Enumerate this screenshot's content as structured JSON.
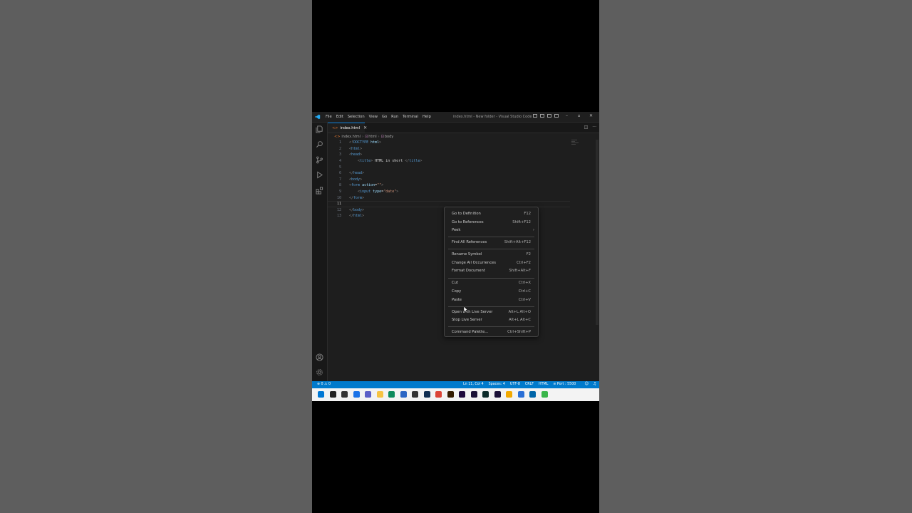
{
  "window": {
    "menu": [
      "File",
      "Edit",
      "Selection",
      "View",
      "Go",
      "Run",
      "Terminal",
      "Help"
    ],
    "title": "index.html - New folder - Visual Studio Code",
    "controls": [
      "–",
      "▫",
      "✕"
    ]
  },
  "tab": {
    "label": "index.html",
    "close": "✕",
    "icon": "html-file-icon"
  },
  "breadcrumb": [
    "index.html",
    "html",
    "body"
  ],
  "editor": {
    "current_line": 11,
    "lines": [
      {
        "n": "1",
        "parts": [
          [
            "br",
            "<!"
          ],
          [
            "tag",
            "DOCTYPE"
          ],
          [
            "txt",
            " "
          ],
          [
            "attr",
            "html"
          ],
          [
            "br",
            ">"
          ]
        ]
      },
      {
        "n": "2",
        "parts": [
          [
            "br",
            "<"
          ],
          [
            "tag",
            "html"
          ],
          [
            "br",
            ">"
          ]
        ]
      },
      {
        "n": "3",
        "parts": [
          [
            "br",
            "<"
          ],
          [
            "tag",
            "head"
          ],
          [
            "br",
            ">"
          ]
        ]
      },
      {
        "n": "4",
        "parts": [
          [
            "txt",
            "    "
          ],
          [
            "br",
            "<"
          ],
          [
            "tag",
            "title"
          ],
          [
            "br",
            ">"
          ],
          [
            "txt",
            " HTML in short "
          ],
          [
            "br",
            "</"
          ],
          [
            "tag",
            "title"
          ],
          [
            "br",
            ">"
          ]
        ]
      },
      {
        "n": "5",
        "parts": []
      },
      {
        "n": "6",
        "parts": [
          [
            "br",
            "</"
          ],
          [
            "tag",
            "head"
          ],
          [
            "br",
            ">"
          ]
        ]
      },
      {
        "n": "7",
        "parts": [
          [
            "br",
            "<"
          ],
          [
            "tag",
            "body"
          ],
          [
            "br",
            ">"
          ]
        ]
      },
      {
        "n": "8",
        "parts": [
          [
            "br",
            "<"
          ],
          [
            "tag",
            "form"
          ],
          [
            "txt",
            " "
          ],
          [
            "attr",
            "action"
          ],
          [
            "txt",
            "="
          ],
          [
            "str",
            "\"\""
          ],
          [
            "br",
            ">"
          ]
        ]
      },
      {
        "n": "9",
        "parts": [
          [
            "txt",
            "    "
          ],
          [
            "br",
            "<"
          ],
          [
            "tag",
            "input"
          ],
          [
            "txt",
            " "
          ],
          [
            "attr",
            "type"
          ],
          [
            "txt",
            "="
          ],
          [
            "str",
            "\"date\""
          ],
          [
            "br",
            ">"
          ]
        ]
      },
      {
        "n": "10",
        "parts": [
          [
            "br",
            "</"
          ],
          [
            "tag",
            "form"
          ],
          [
            "br",
            ">"
          ]
        ]
      },
      {
        "n": "11",
        "parts": []
      },
      {
        "n": "12",
        "parts": [
          [
            "br",
            "</"
          ],
          [
            "tag",
            "body"
          ],
          [
            "br",
            ">"
          ]
        ]
      },
      {
        "n": "13",
        "parts": [
          [
            "br",
            "</"
          ],
          [
            "tag",
            "html"
          ],
          [
            "br",
            ">"
          ]
        ]
      }
    ]
  },
  "context_menu": {
    "groups": [
      [
        {
          "label": "Go to Definition",
          "key": "F12"
        },
        {
          "label": "Go to References",
          "key": "Shift+F12"
        },
        {
          "label": "Peek",
          "key": "",
          "submenu": "›"
        }
      ],
      [
        {
          "label": "Find All References",
          "key": "Shift+Alt+F12"
        }
      ],
      [
        {
          "label": "Rename Symbol",
          "key": "F2"
        },
        {
          "label": "Change All Occurrences",
          "key": "Ctrl+F2"
        },
        {
          "label": "Format Document",
          "key": "Shift+Alt+F"
        }
      ],
      [
        {
          "label": "Cut",
          "key": "Ctrl+X"
        },
        {
          "label": "Copy",
          "key": "Ctrl+C"
        },
        {
          "label": "Paste",
          "key": "Ctrl+V"
        }
      ],
      [
        {
          "label": "Open with Live Server",
          "key": "Alt+L Alt+O"
        },
        {
          "label": "Stop Live Server",
          "key": "Alt+L Alt+C"
        }
      ],
      [
        {
          "label": "Command Palette...",
          "key": "Ctrl+Shift+P"
        }
      ]
    ]
  },
  "statusbar": {
    "problems": "⊗ 0 ⚠ 0",
    "position": "Ln 11, Col 4",
    "spaces": "Spaces: 4",
    "encoding": "UTF-8",
    "eol": "CRLF",
    "language": "HTML",
    "port": "⊘ Port : 5500"
  },
  "colors": {
    "editor_bg": "#1e1e1e",
    "statusbar": "#007acc",
    "tag": "#569cd6",
    "attr": "#9cdcfe",
    "string": "#ce9178"
  },
  "taskbar_icons": [
    {
      "name": "start-icon",
      "color": "#0078d4"
    },
    {
      "name": "search-icon",
      "color": "#222222"
    },
    {
      "name": "task-view-icon",
      "color": "#333333"
    },
    {
      "name": "widgets-icon",
      "color": "#1a73e8"
    },
    {
      "name": "chat-icon",
      "color": "#5b5fc7"
    },
    {
      "name": "file-explorer-icon",
      "color": "#f6c342"
    },
    {
      "name": "edge-icon",
      "color": "#0c8a5c"
    },
    {
      "name": "store-icon",
      "color": "#2b66c4"
    },
    {
      "name": "obs-icon",
      "color": "#333333"
    },
    {
      "name": "photoshop-icon",
      "color": "#0f2d50"
    },
    {
      "name": "chrome-icon",
      "color": "#db4437"
    },
    {
      "name": "illustrator-icon",
      "color": "#331c00"
    },
    {
      "name": "after-effects-icon",
      "color": "#1f0a3d"
    },
    {
      "name": "premiere-icon",
      "color": "#1b1137"
    },
    {
      "name": "audition-icon",
      "color": "#0b2a29"
    },
    {
      "name": "media-encoder-icon",
      "color": "#1b1137"
    },
    {
      "name": "chrome-canary-icon",
      "color": "#f2a900"
    },
    {
      "name": "notepad-icon",
      "color": "#2a6fd6"
    },
    {
      "name": "vscode-icon",
      "color": "#0065a9"
    },
    {
      "name": "browser-icon",
      "color": "#3ab54a"
    }
  ]
}
